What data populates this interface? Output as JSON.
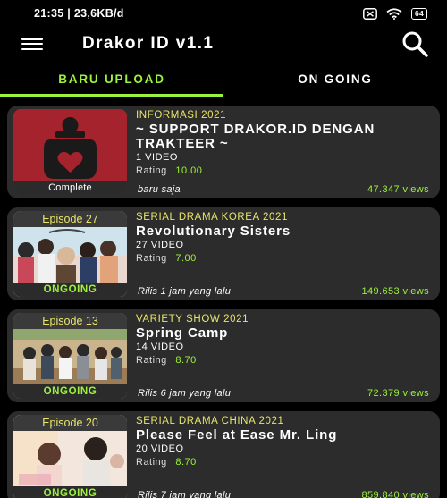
{
  "status_bar": {
    "time": "21:35",
    "speed": "23,6KB/d",
    "battery": "64"
  },
  "app": {
    "title": "Drakor ID v1.1"
  },
  "tabs": [
    {
      "label": "BARU UPLOAD",
      "active": true
    },
    {
      "label": "ON GOING",
      "active": false
    }
  ],
  "icons": {
    "menu": "menu-icon",
    "search": "search-icon",
    "wifi": "wifi-icon",
    "mute": "mute-icon",
    "battery": "battery-icon"
  },
  "colors": {
    "accent": "#9cf23c",
    "category": "#e9e56a",
    "card": "#2c2c2c",
    "logo_red": "#a5232d"
  },
  "items": [
    {
      "badge_top": "",
      "badge_bottom": "Complete",
      "category": "INFORMASI 2021",
      "title_line1": "~ SUPPORT DRAKOR.ID DENGAN",
      "title_line2": "TRAKTEER ~",
      "video_count": "1 VIDEO",
      "rating_label": "Rating",
      "rating": "10.00",
      "time": "baru saja",
      "views": "47.347 views"
    },
    {
      "badge_top": "Episode 27",
      "badge_bottom": "ONGOING",
      "category": "SERIAL DRAMA KOREA 2021",
      "title_line1": "Revolutionary Sisters",
      "title_line2": "",
      "video_count": "27 VIDEO",
      "rating_label": "Rating",
      "rating": "7.00",
      "time": "Rilis 1 jam yang lalu",
      "views": "149.653 views"
    },
    {
      "badge_top": "Episode 13",
      "badge_bottom": "ONGOING",
      "category": "VARIETY SHOW 2021",
      "title_line1": "Spring Camp",
      "title_line2": "",
      "video_count": "14 VIDEO",
      "rating_label": "Rating",
      "rating": "8.70",
      "time": "Rilis 6 jam yang lalu",
      "views": "72.379 views"
    },
    {
      "badge_top": "Episode 20",
      "badge_bottom": "ONGOING",
      "category": "SERIAL DRAMA CHINA 2021",
      "title_line1": "Please Feel at Ease Mr. Ling",
      "title_line2": "",
      "video_count": "20 VIDEO",
      "rating_label": "Rating",
      "rating": "8.70",
      "time": "Rilis 7 jam yang lalu",
      "views": "859.840 views"
    }
  ]
}
